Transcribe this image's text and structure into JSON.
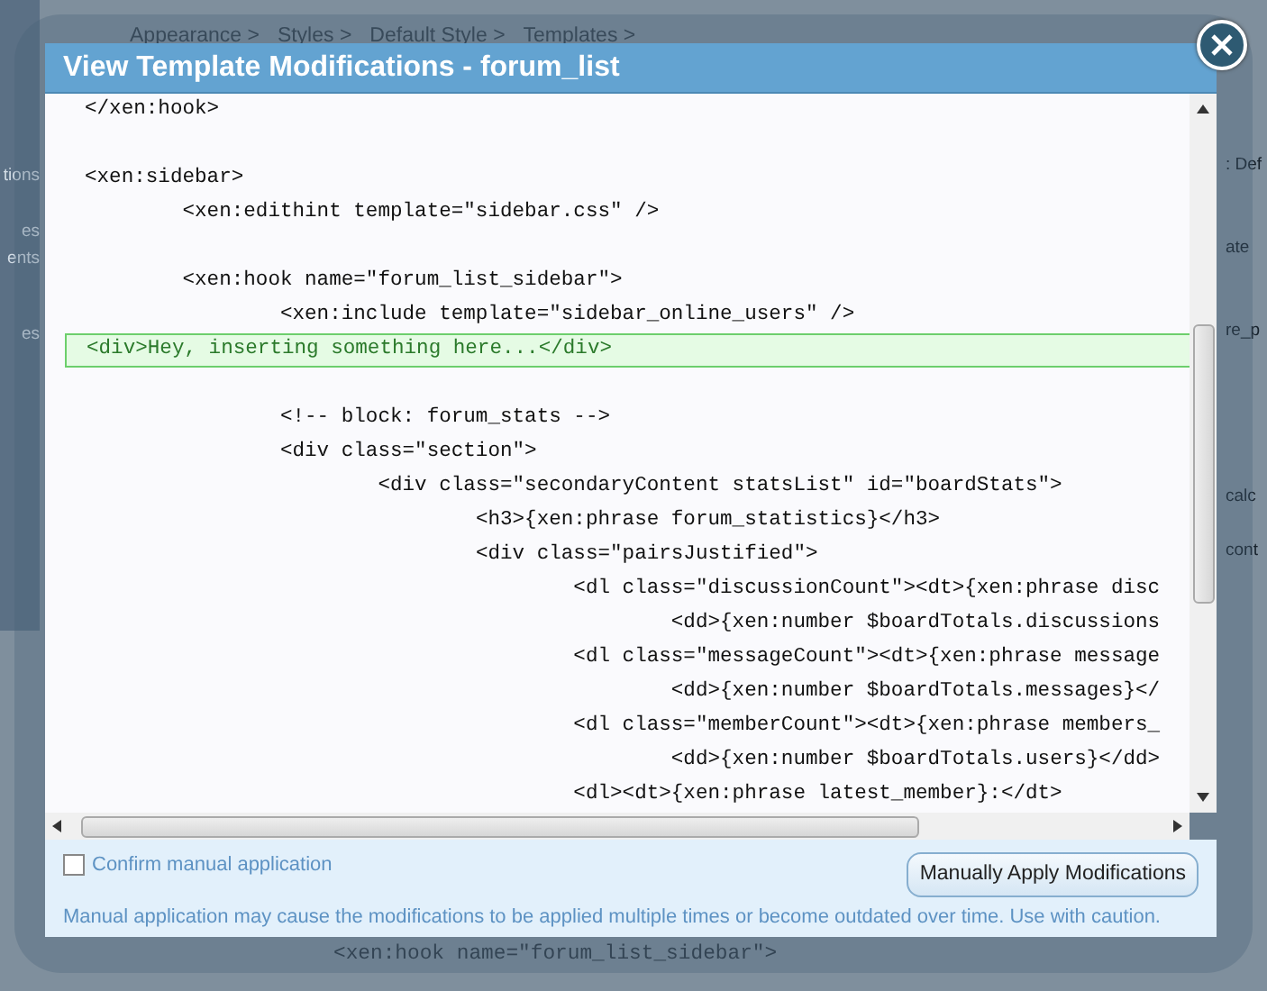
{
  "background": {
    "breadcrumb": [
      "Appearance >",
      "Styles >",
      "Default Style >",
      "Templates >"
    ],
    "left_fragments": [
      "tions",
      "es",
      "ents",
      "es"
    ],
    "right_fragments": [
      ": Def",
      "ate",
      "re_p",
      "calc",
      "cont"
    ],
    "code_line": "<xen:hook name=\"forum_list_sidebar\">"
  },
  "dialog": {
    "title": "View Template Modifications - forum_list",
    "code_lines": [
      {
        "text": "</xen:hook>",
        "kind": "context"
      },
      {
        "kind": "blank"
      },
      {
        "text": "<xen:sidebar>",
        "kind": "context"
      },
      {
        "text": "\t<xen:edithint template=\"sidebar.css\" />",
        "kind": "context"
      },
      {
        "kind": "blank"
      },
      {
        "text": "\t<xen:hook name=\"forum_list_sidebar\">",
        "kind": "context"
      },
      {
        "text": "\t\t<xen:include template=\"sidebar_online_users\" />",
        "kind": "context"
      },
      {
        "text": "<div>Hey, inserting something here...</div>",
        "kind": "inserted"
      },
      {
        "kind": "blank"
      },
      {
        "text": "\t\t<!-- block: forum_stats -->",
        "kind": "context"
      },
      {
        "text": "\t\t<div class=\"section\">",
        "kind": "context"
      },
      {
        "text": "\t\t\t<div class=\"secondaryContent statsList\" id=\"boardStats\">",
        "kind": "context"
      },
      {
        "text": "\t\t\t\t<h3>{xen:phrase forum_statistics}</h3>",
        "kind": "context"
      },
      {
        "text": "\t\t\t\t<div class=\"pairsJustified\">",
        "kind": "context"
      },
      {
        "text": "\t\t\t\t\t<dl class=\"discussionCount\"><dt>{xen:phrase disc",
        "kind": "context"
      },
      {
        "text": "\t\t\t\t\t\t<dd>{xen:number $boardTotals.discussions",
        "kind": "context"
      },
      {
        "text": "\t\t\t\t\t<dl class=\"messageCount\"><dt>{xen:phrase message",
        "kind": "context"
      },
      {
        "text": "\t\t\t\t\t\t<dd>{xen:number $boardTotals.messages}</",
        "kind": "context"
      },
      {
        "text": "\t\t\t\t\t<dl class=\"memberCount\"><dt>{xen:phrase members_",
        "kind": "context"
      },
      {
        "text": "\t\t\t\t\t\t<dd>{xen:number $boardTotals.users}</dd>",
        "kind": "context"
      },
      {
        "text": "\t\t\t\t\t<dl><dt>{xen:phrase latest_member}:</dt>",
        "kind": "context"
      }
    ],
    "confirm": {
      "label": "Confirm manual application",
      "checked": false
    },
    "apply_button": "Manually Apply Modifications",
    "caution": "Manual application may cause the modifications to be applied multiple times or become outdated over time. Use with caution."
  }
}
